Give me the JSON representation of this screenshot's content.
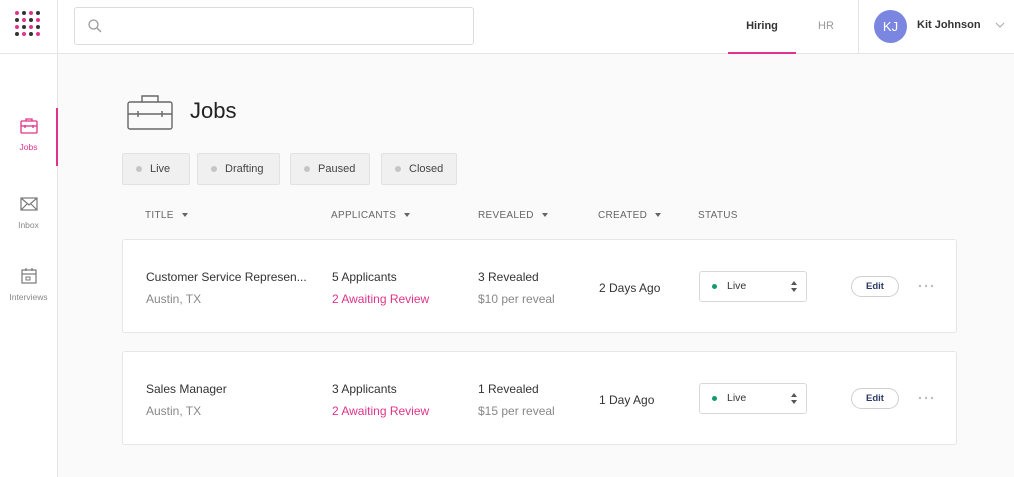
{
  "search": {
    "placeholder": ""
  },
  "nav": {
    "tabs": [
      {
        "label": "Hiring",
        "active": true
      },
      {
        "label": "HR",
        "active": false
      }
    ]
  },
  "user": {
    "initials": "KJ",
    "name": "Kit Johnson",
    "avatar_color": "#7b86e0"
  },
  "sidebar": {
    "items": [
      {
        "label": "Jobs",
        "icon": "briefcase-icon",
        "active": true
      },
      {
        "label": "Inbox",
        "icon": "envelope-icon",
        "active": false
      },
      {
        "label": "Interviews",
        "icon": "calendar-icon",
        "active": false
      }
    ]
  },
  "page": {
    "title": "Jobs"
  },
  "filters": [
    {
      "label": "Live"
    },
    {
      "label": "Drafting"
    },
    {
      "label": "Paused"
    },
    {
      "label": "Closed"
    }
  ],
  "columns": {
    "title": "TITLE",
    "applicants": "APPLICANTS",
    "revealed": "REVEALED",
    "created": "CREATED",
    "status": "STATUS"
  },
  "jobs": [
    {
      "title": "Customer Service Represen...",
      "location": "Austin, TX",
      "applicants": "5 Applicants",
      "awaiting": "2 Awaiting Review",
      "revealed": "3 Revealed",
      "price": "$10 per reveal",
      "created": "2 Days Ago",
      "status": "Live",
      "edit_label": "Edit"
    },
    {
      "title": "Sales Manager",
      "location": "Austin, TX",
      "applicants": "3 Applicants",
      "awaiting": "2 Awaiting Review",
      "revealed": "1 Revealed",
      "price": "$15 per reveal",
      "created": "1 Day Ago",
      "status": "Live",
      "edit_label": "Edit"
    }
  ],
  "colors": {
    "accent": "#e0338a",
    "live_status": "#159a6e",
    "edit_text": "#2b3a67"
  }
}
